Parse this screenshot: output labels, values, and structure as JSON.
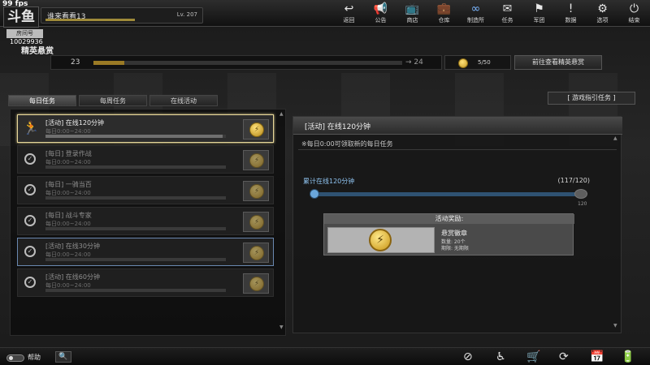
{
  "hud": {
    "fps": "99 fps",
    "logo_text": "斗鱼",
    "room_tag": "房间号",
    "room_number": "10029936"
  },
  "player": {
    "name": "谁来看看13",
    "level": "Lv. 207"
  },
  "nav": [
    {
      "icon": "↩",
      "label": "返回"
    },
    {
      "icon": "📢",
      "label": "公告"
    },
    {
      "icon": "📺",
      "label": "商店"
    },
    {
      "icon": "💼",
      "label": "仓库"
    },
    {
      "icon": "∞",
      "label": "制造所"
    },
    {
      "icon": "✉",
      "label": "任务"
    },
    {
      "icon": "⚑",
      "label": "军团"
    },
    {
      "icon": "!",
      "label": "数据"
    },
    {
      "icon": "⚙",
      "label": "选项"
    },
    {
      "icon": "⏻",
      "label": "结束"
    }
  ],
  "page": {
    "title": "精英悬赏",
    "rank_current": "23",
    "rank_next": "→ 24",
    "rank_progress": 0.1,
    "coin_count": "5/50",
    "elite_button": "前往查看精英悬赏"
  },
  "tabs": [
    "每日任务",
    "每周任务",
    "在线活动"
  ],
  "guide_button": "[ 游戏指引任务 ]",
  "missions": [
    {
      "title": "[活动] 在线120分钟",
      "time": "每日0:00~24:00",
      "progress": 0.98,
      "state": "selected"
    },
    {
      "title": "[每日] 登录作战",
      "time": "每日0:00~24:00",
      "progress": 0,
      "state": "done"
    },
    {
      "title": "[每日] 一骑当百",
      "time": "每日0:00~24:00",
      "progress": 0,
      "state": "done"
    },
    {
      "title": "[每日] 战斗专家",
      "time": "每日0:00~24:00",
      "progress": 0,
      "state": "done"
    },
    {
      "title": "[活动] 在线30分钟",
      "time": "每日0:00~24:00",
      "progress": 0,
      "state": "hover"
    },
    {
      "title": "[活动] 在线60分钟",
      "time": "每日0:00~24:00",
      "progress": 0,
      "state": "done"
    }
  ],
  "detail": {
    "title": "[活动] 在线120分钟",
    "note": "※每日0:00可领取新的每日任务",
    "progress_label": "累计在线120分钟",
    "progress_count": "(117/120)",
    "progress_end": "120",
    "reward_header": "活动奖励:",
    "reward_name": "悬赏徽章",
    "reward_qty": "数量: 20个",
    "reward_expiry": "期限: 无期限"
  },
  "bottom": {
    "help_label": "帮助",
    "search_icon": "🔍",
    "icons": [
      "⊘",
      "♿",
      "🛒",
      "⟳",
      "📅",
      "🔋"
    ]
  }
}
